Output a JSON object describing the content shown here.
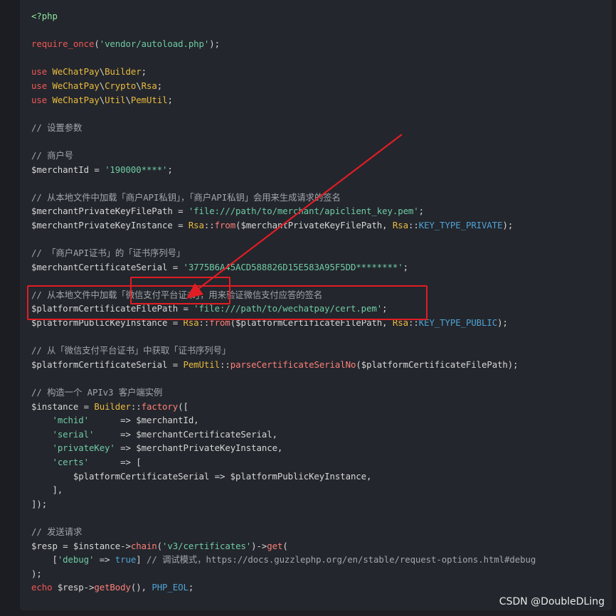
{
  "colors": {
    "background": "#1b1d22",
    "panel": "#23262c",
    "keyword": "#f05757",
    "class": "#e9bb3f",
    "string": "#6fcaa4",
    "comment": "#a2a6ad",
    "function": "#ff7f79",
    "constant": "#4fa3d6",
    "annotation": "#e11d24"
  },
  "watermark": "CSDN @DoubleDLing",
  "code_lines": [
    [
      {
        "t": "phptag",
        "v": "<?php"
      }
    ],
    [],
    [
      {
        "t": "keyword",
        "v": "require_once"
      },
      {
        "t": "plain",
        "v": "("
      },
      {
        "t": "string",
        "v": "'vendor/autoload.php'"
      },
      {
        "t": "plain",
        "v": ");"
      }
    ],
    [],
    [
      {
        "t": "keyword",
        "v": "use "
      },
      {
        "t": "class",
        "v": "WeChatPay"
      },
      {
        "t": "plain",
        "v": "\\"
      },
      {
        "t": "class",
        "v": "Builder"
      },
      {
        "t": "plain",
        "v": ";"
      }
    ],
    [
      {
        "t": "keyword",
        "v": "use "
      },
      {
        "t": "class",
        "v": "WeChatPay"
      },
      {
        "t": "plain",
        "v": "\\"
      },
      {
        "t": "class",
        "v": "Crypto"
      },
      {
        "t": "plain",
        "v": "\\"
      },
      {
        "t": "class",
        "v": "Rsa"
      },
      {
        "t": "plain",
        "v": ";"
      }
    ],
    [
      {
        "t": "keyword",
        "v": "use "
      },
      {
        "t": "class",
        "v": "WeChatPay"
      },
      {
        "t": "plain",
        "v": "\\"
      },
      {
        "t": "class",
        "v": "Util"
      },
      {
        "t": "plain",
        "v": "\\"
      },
      {
        "t": "class",
        "v": "PemUtil"
      },
      {
        "t": "plain",
        "v": ";"
      }
    ],
    [],
    [
      {
        "t": "comment",
        "v": "// 设置参数"
      }
    ],
    [],
    [
      {
        "t": "comment",
        "v": "// 商户号"
      }
    ],
    [
      {
        "t": "variable",
        "v": "$merchantId"
      },
      {
        "t": "plain",
        "v": " = "
      },
      {
        "t": "string",
        "v": "'190000****'"
      },
      {
        "t": "plain",
        "v": ";"
      }
    ],
    [],
    [
      {
        "t": "comment",
        "v": "// 从本地文件中加载「商户API私钥」，「商户API私钥」会用来生成请求的签名"
      }
    ],
    [
      {
        "t": "variable",
        "v": "$merchantPrivateKeyFilePath"
      },
      {
        "t": "plain",
        "v": " = "
      },
      {
        "t": "string",
        "v": "'file:///path/to/merchant/apiclient_key.pem'"
      },
      {
        "t": "plain",
        "v": ";"
      }
    ],
    [
      {
        "t": "variable",
        "v": "$merchantPrivateKeyInstance"
      },
      {
        "t": "plain",
        "v": " = "
      },
      {
        "t": "class",
        "v": "Rsa"
      },
      {
        "t": "plain",
        "v": "::"
      },
      {
        "t": "function",
        "v": "from"
      },
      {
        "t": "plain",
        "v": "($merchantPrivateKeyFilePath, "
      },
      {
        "t": "class",
        "v": "Rsa"
      },
      {
        "t": "plain",
        "v": "::"
      },
      {
        "t": "constant",
        "v": "KEY_TYPE_PRIVATE"
      },
      {
        "t": "plain",
        "v": ");"
      }
    ],
    [],
    [
      {
        "t": "comment",
        "v": "// 「商户API证书」的「证书序列号」"
      }
    ],
    [
      {
        "t": "variable",
        "v": "$merchantCertificateSerial"
      },
      {
        "t": "plain",
        "v": " = "
      },
      {
        "t": "string",
        "v": "'3775B6A45ACD588826D15E583A95F5DD********'"
      },
      {
        "t": "plain",
        "v": ";"
      }
    ],
    [],
    [
      {
        "t": "comment",
        "v": "// 从本地文件中加载「微信支付平台证书」，用来验证微信支付应答的签名"
      }
    ],
    [
      {
        "t": "variable",
        "v": "$platformCertificateFilePath"
      },
      {
        "t": "plain",
        "v": " = "
      },
      {
        "t": "string",
        "v": "'file:///path/to/wechatpay/cert.pem'"
      },
      {
        "t": "plain",
        "v": ";"
      }
    ],
    [
      {
        "t": "variable",
        "v": "$platformPublicKeyInstance"
      },
      {
        "t": "plain",
        "v": " = "
      },
      {
        "t": "class",
        "v": "Rsa"
      },
      {
        "t": "plain",
        "v": "::"
      },
      {
        "t": "function",
        "v": "from"
      },
      {
        "t": "plain",
        "v": "($platformCertificateFilePath, "
      },
      {
        "t": "class",
        "v": "Rsa"
      },
      {
        "t": "plain",
        "v": "::"
      },
      {
        "t": "constant",
        "v": "KEY_TYPE_PUBLIC"
      },
      {
        "t": "plain",
        "v": ");"
      }
    ],
    [],
    [
      {
        "t": "comment",
        "v": "// 从「微信支付平台证书」中获取「证书序列号」"
      }
    ],
    [
      {
        "t": "variable",
        "v": "$platformCertificateSerial"
      },
      {
        "t": "plain",
        "v": " = "
      },
      {
        "t": "class",
        "v": "PemUtil"
      },
      {
        "t": "plain",
        "v": "::"
      },
      {
        "t": "function",
        "v": "parseCertificateSerialNo"
      },
      {
        "t": "plain",
        "v": "($platformCertificateFilePath);"
      }
    ],
    [],
    [
      {
        "t": "comment",
        "v": "// 构造一个 APIv3 客户端实例"
      }
    ],
    [
      {
        "t": "variable",
        "v": "$instance"
      },
      {
        "t": "plain",
        "v": " = "
      },
      {
        "t": "class",
        "v": "Builder"
      },
      {
        "t": "plain",
        "v": "::"
      },
      {
        "t": "function",
        "v": "factory"
      },
      {
        "t": "plain",
        "v": "(["
      }
    ],
    [
      {
        "t": "plain",
        "v": "    "
      },
      {
        "t": "string",
        "v": "'mchid'"
      },
      {
        "t": "plain",
        "v": "      => $merchantId,"
      }
    ],
    [
      {
        "t": "plain",
        "v": "    "
      },
      {
        "t": "string",
        "v": "'serial'"
      },
      {
        "t": "plain",
        "v": "     => $merchantCertificateSerial,"
      }
    ],
    [
      {
        "t": "plain",
        "v": "    "
      },
      {
        "t": "string",
        "v": "'privateKey'"
      },
      {
        "t": "plain",
        "v": " => $merchantPrivateKeyInstance,"
      }
    ],
    [
      {
        "t": "plain",
        "v": "    "
      },
      {
        "t": "string",
        "v": "'certs'"
      },
      {
        "t": "plain",
        "v": "      => ["
      }
    ],
    [
      {
        "t": "plain",
        "v": "        $platformCertificateSerial => $platformPublicKeyInstance,"
      }
    ],
    [
      {
        "t": "plain",
        "v": "    ],"
      }
    ],
    [
      {
        "t": "plain",
        "v": "]);"
      }
    ],
    [],
    [
      {
        "t": "comment",
        "v": "// 发送请求"
      }
    ],
    [
      {
        "t": "variable",
        "v": "$resp"
      },
      {
        "t": "plain",
        "v": " = $instance->"
      },
      {
        "t": "function",
        "v": "chain"
      },
      {
        "t": "plain",
        "v": "("
      },
      {
        "t": "string",
        "v": "'v3/certificates'"
      },
      {
        "t": "plain",
        "v": ")->"
      },
      {
        "t": "function",
        "v": "get"
      },
      {
        "t": "plain",
        "v": "("
      }
    ],
    [
      {
        "t": "plain",
        "v": "    ["
      },
      {
        "t": "string",
        "v": "'debug'"
      },
      {
        "t": "plain",
        "v": " => "
      },
      {
        "t": "constant",
        "v": "true"
      },
      {
        "t": "plain",
        "v": "] "
      },
      {
        "t": "comment",
        "v": "// 调试模式，"
      },
      {
        "t": "link",
        "v": "https://docs.guzzlephp.org/en/stable/request-options.html#debug"
      }
    ],
    [
      {
        "t": "plain",
        "v": ");"
      }
    ],
    [
      {
        "t": "keyword",
        "v": "echo"
      },
      {
        "t": "plain",
        "v": " $resp->"
      },
      {
        "t": "function",
        "v": "getBody"
      },
      {
        "t": "plain",
        "v": "(), "
      },
      {
        "t": "constant",
        "v": "PHP_EOL"
      },
      {
        "t": "plain",
        "v": ";"
      }
    ]
  ]
}
